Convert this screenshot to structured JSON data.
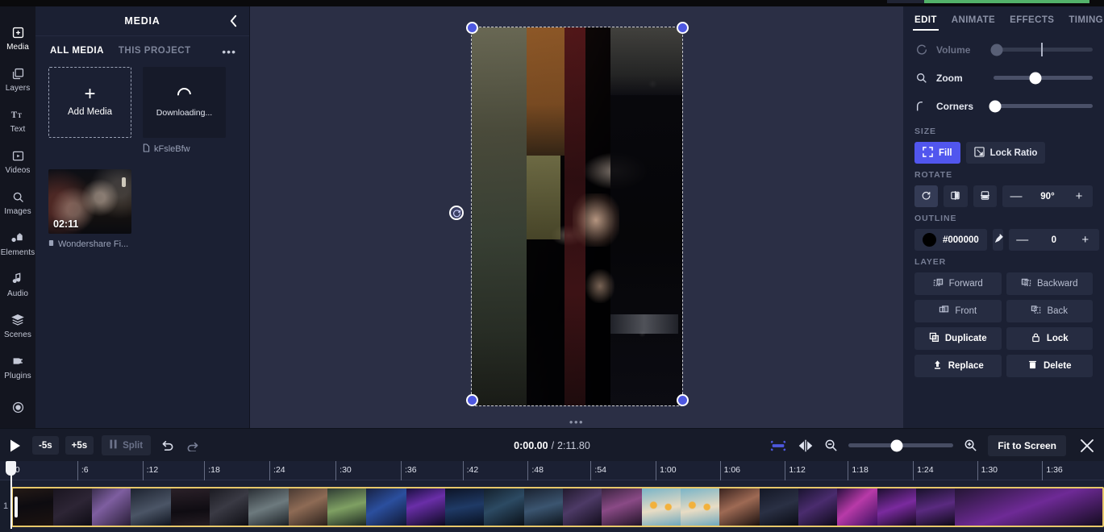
{
  "app": {
    "accent": "#5156ee",
    "panel_bg": "#1b2033",
    "canvas_bg": "#2b2f45",
    "clip_border": "#e8c86a"
  },
  "rail": {
    "items": [
      {
        "label": "Media",
        "icon": "media-icon",
        "active": true
      },
      {
        "label": "Layers",
        "icon": "layers-icon",
        "active": false
      },
      {
        "label": "Text",
        "icon": "text-icon",
        "active": false
      },
      {
        "label": "Videos",
        "icon": "videos-icon",
        "active": false
      },
      {
        "label": "Images",
        "icon": "search-icon",
        "active": false
      },
      {
        "label": "Elements",
        "icon": "elements-icon",
        "active": false
      },
      {
        "label": "Audio",
        "icon": "audio-icon",
        "active": false
      },
      {
        "label": "Scenes",
        "icon": "scenes-icon",
        "active": false
      },
      {
        "label": "Plugins",
        "icon": "plugins-icon",
        "active": false
      }
    ]
  },
  "media_panel": {
    "title": "MEDIA",
    "collapse_icon": "chevron-left-icon",
    "more_icon": "more-options-icon",
    "more_glyph": "•••",
    "tabs": [
      {
        "label": "ALL MEDIA",
        "active": true
      },
      {
        "label": "THIS PROJECT",
        "active": false
      }
    ],
    "add_media": {
      "label": "Add Media",
      "plus": "+"
    },
    "items": [
      {
        "type": "downloading",
        "status_label": "Downloading...",
        "caption": "kFsleBfw",
        "caption_icon": "file-icon"
      },
      {
        "type": "video",
        "duration": "02:11",
        "caption": "Wondershare Fi...",
        "caption_icon": "video-file-icon"
      }
    ]
  },
  "properties": {
    "tabs": [
      {
        "label": "EDIT",
        "active": true
      },
      {
        "label": "ANIMATE",
        "active": false
      },
      {
        "label": "EFFECTS",
        "active": false
      },
      {
        "label": "TIMING",
        "active": false
      }
    ],
    "sliders": [
      {
        "name": "volume",
        "label": "Volume",
        "icon": "volume-icon",
        "value_pct": 3,
        "disabled": true,
        "tick_pct": 48
      },
      {
        "name": "zoom",
        "label": "Zoom",
        "icon": "zoom-icon",
        "value_pct": 42,
        "disabled": false,
        "tick_pct": null
      },
      {
        "name": "corners",
        "label": "Corners",
        "icon": "corners-icon",
        "value_pct": 2,
        "disabled": false,
        "tick_pct": null
      }
    ],
    "size": {
      "title": "SIZE",
      "fill_label": "Fill",
      "fill_icon": "fill-icon",
      "lock_ratio_label": "Lock Ratio",
      "lock_ratio_icon": "lock-ratio-icon"
    },
    "rotate": {
      "title": "ROTATE",
      "reset_icon": "rotate-reset-icon",
      "flip_h_icon": "flip-horizontal-icon",
      "flip_v_icon": "flip-vertical-icon",
      "minus": "—",
      "value": "90°",
      "plus": "+"
    },
    "outline": {
      "title": "OUTLINE",
      "color": "#000000",
      "color_hex": "#000000",
      "picker_icon": "eyedropper-icon",
      "minus": "—",
      "value": "0",
      "plus": "+"
    },
    "layer": {
      "title": "LAYER",
      "buttons": [
        {
          "label": "Forward",
          "icon": "bring-forward-icon",
          "strong": false
        },
        {
          "label": "Backward",
          "icon": "send-backward-icon",
          "strong": false
        },
        {
          "label": "Front",
          "icon": "bring-front-icon",
          "strong": false
        },
        {
          "label": "Back",
          "icon": "send-back-icon",
          "strong": false
        },
        {
          "label": "Duplicate",
          "icon": "duplicate-icon",
          "strong": true
        },
        {
          "label": "Lock",
          "icon": "lock-icon",
          "strong": true
        },
        {
          "label": "Replace",
          "icon": "replace-icon",
          "strong": true
        },
        {
          "label": "Delete",
          "icon": "trash-icon",
          "strong": true
        }
      ]
    }
  },
  "canvas": {
    "grip_glyph": "•••",
    "rotate_handle_icon": "rotate-handle-icon",
    "handles": [
      "top-left",
      "top-right",
      "bottom-left",
      "bottom-right"
    ]
  },
  "transport": {
    "play_icon": "play-icon",
    "back_5s": "-5s",
    "forward_5s": "+5s",
    "split_label": "Split",
    "split_icon": "split-icon",
    "undo_icon": "undo-icon",
    "redo_icon": "redo-icon",
    "current_time": "0:00.00",
    "separator": "/",
    "total_time": "2:11.80",
    "magnet_icon": "magnet-icon",
    "mirror_icon": "mirror-icon",
    "zoom_out_icon": "zoom-out-icon",
    "zoom_in_icon": "zoom-in-icon",
    "zoom_value_pct": 46,
    "fit_label": "Fit to Screen",
    "close_icon": "close-icon"
  },
  "timeline": {
    "track_label": "1",
    "playhead_pct": 1.0,
    "ticks": [
      {
        "label": "0",
        "pct": 1.0
      },
      {
        "label": ":6",
        "pct": 7.0
      },
      {
        "label": ":12",
        "pct": 12.9
      },
      {
        "label": ":18",
        "pct": 18.5
      },
      {
        "label": ":24",
        "pct": 24.4
      },
      {
        "label": ":30",
        "pct": 30.4
      },
      {
        "label": ":36",
        "pct": 36.3
      },
      {
        "label": ":42",
        "pct": 41.9
      },
      {
        "label": ":48",
        "pct": 47.8
      },
      {
        "label": ":54",
        "pct": 53.5
      },
      {
        "label": "1:00",
        "pct": 59.4
      },
      {
        "label": "1:06",
        "pct": 65.2
      },
      {
        "label": "1:12",
        "pct": 71.1
      },
      {
        "label": "1:18",
        "pct": 76.8
      },
      {
        "label": "1:24",
        "pct": 82.7
      },
      {
        "label": "1:30",
        "pct": 88.5
      },
      {
        "label": "1:36",
        "pct": 94.4
      }
    ],
    "frames": [
      {
        "w": 50,
        "css": "linear-gradient(170deg,#241a16 0%,#0d0b10 45%,#1c1310 100%)"
      },
      {
        "w": 48,
        "css": "linear-gradient(150deg,#1a1520 0%,#2d2535 50%,#0e0c14 100%)"
      },
      {
        "w": 48,
        "css": "linear-gradient(140deg,#3b2f4e 0%,#7e5ea0 40%,#2a1f38 100%)"
      },
      {
        "w": 50,
        "css": "linear-gradient(160deg,#1d2330 0%,#4b5566 55%,#101520 100%)"
      },
      {
        "w": 48,
        "css": "linear-gradient(175deg,#2a2028 0%,#0f0c12 60%,#241c22 100%)"
      },
      {
        "w": 48,
        "css": "linear-gradient(150deg,#1b1b22 0%,#3a3a44 45%,#0e0e14 100%)"
      },
      {
        "w": 50,
        "css": "linear-gradient(160deg,#2a2f35 0%,#6d7a7e 50%,#1c2126 100%)"
      },
      {
        "w": 48,
        "css": "linear-gradient(155deg,#4a3a33 0%,#8e6b55 45%,#2b211c 100%)"
      },
      {
        "w": 48,
        "css": "linear-gradient(165deg,#2f3c34 0%,#7fa063 50%,#1e2a22 100%)"
      },
      {
        "w": 50,
        "css": "linear-gradient(150deg,#182244 0%,#2b4f9e 45%,#101834 100%)"
      },
      {
        "w": 48,
        "css": "linear-gradient(160deg,#1a1040 0%,#6a2ea8 40%,#0c0a22 100%)"
      },
      {
        "w": 48,
        "css": "linear-gradient(170deg,#0d1426 0%,#1f3a66 50%,#081020 100%)"
      },
      {
        "w": 50,
        "css": "linear-gradient(155deg,#14202c 0%,#2c4a63 45%,#0a1018 100%)"
      },
      {
        "w": 48,
        "css": "linear-gradient(165deg,#1a2230 0%,#3b5570 50%,#0d141c 100%)"
      },
      {
        "w": 48,
        "css": "linear-gradient(150deg,#221a2e 0%,#4d3a66 45%,#120d1c 100%)"
      },
      {
        "w": 50,
        "css": "linear-gradient(160deg,#3a2440 0%,#8a4a86 45%,#221428 100%)"
      },
      {
        "w": 48,
        "css": "linear-gradient(170deg,#7fb3c8 0%,#e8c49a 50%,#c87a4a 100%)"
      },
      {
        "w": 48,
        "css": "linear-gradient(170deg,#7fb3c8 0%,#e8c49a 50%,#c87a4a 100%)"
      },
      {
        "w": 50,
        "css": "linear-gradient(155deg,#3a2420 0%,#9e6a54 45%,#1c1210 100%)"
      },
      {
        "w": 48,
        "css": "linear-gradient(160deg,#141826 0%,#2a3044 50%,#0a0c14 100%)"
      },
      {
        "w": 48,
        "css": "linear-gradient(150deg,#1a1430 0%,#4a2c6e 45%,#0e0a1a 100%)"
      },
      {
        "w": 50,
        "css": "linear-gradient(140deg,#2a1040 0%,#b83aa8 45%,#3a1060 100%)"
      },
      {
        "w": 48,
        "css": "linear-gradient(160deg,#1e1030 0%,#7a2a9e 50%,#140a20 100%)"
      }
    ]
  }
}
